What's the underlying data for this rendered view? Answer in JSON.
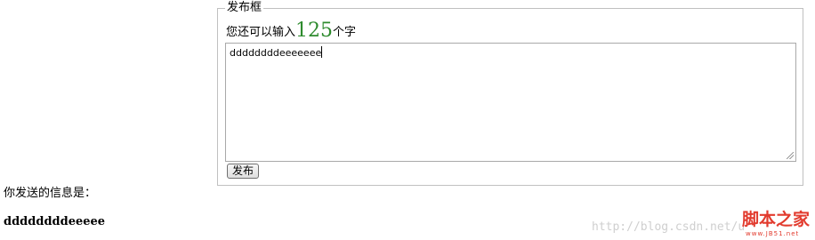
{
  "form": {
    "legend": "发布框",
    "counter_prefix": "您还可以输入",
    "counter_value": "125",
    "counter_suffix": "个字",
    "textarea_value": "ddddddddeeeeeee",
    "publish_label": "发布"
  },
  "output": {
    "label": "你发送的信息是：",
    "message": "ddddddddeeeee"
  },
  "watermark": {
    "url": "http://blog.csdn.net/u",
    "logo_text": "脚本之家",
    "logo_subtext": "www.JB51.net"
  },
  "colors": {
    "counter_number": "#2e8b2e",
    "logo": "#e23b2e"
  }
}
